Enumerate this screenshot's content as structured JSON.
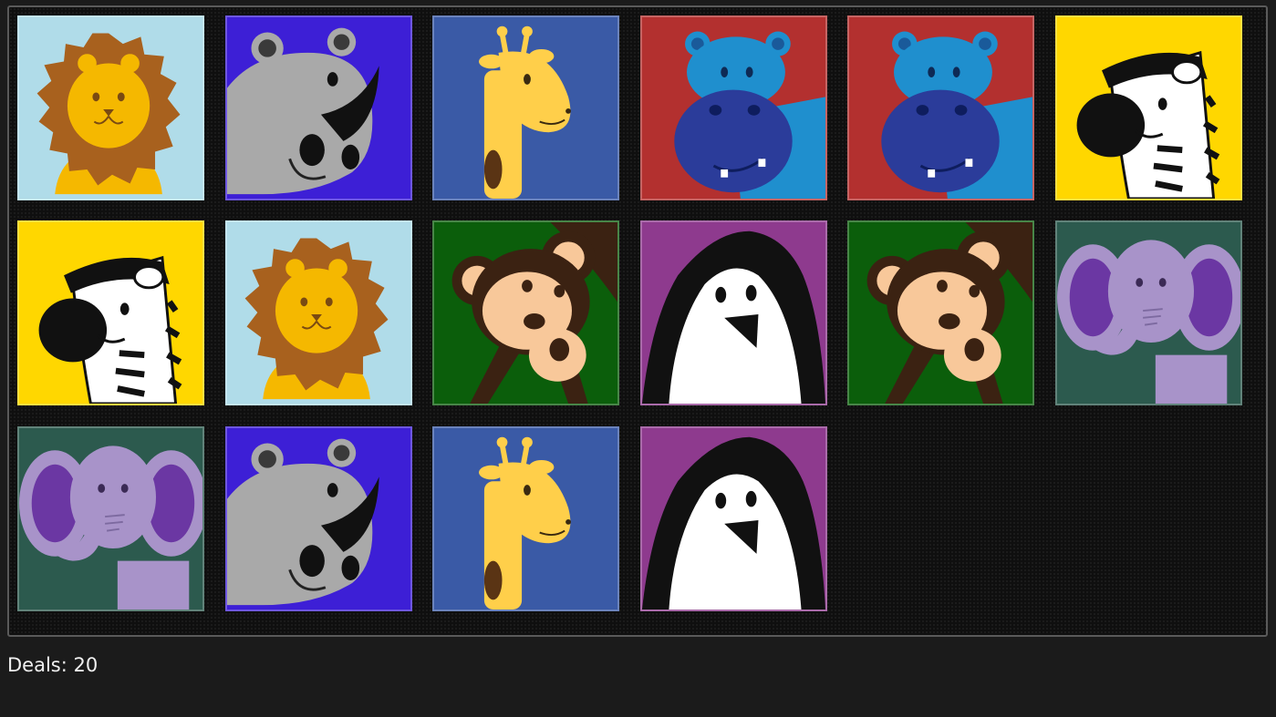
{
  "status": {
    "deals_label": "Deals: 20"
  },
  "board": {
    "cards": [
      {
        "animal": "lion",
        "background": "#b0dce9"
      },
      {
        "animal": "rhino",
        "background": "#3d1fd6"
      },
      {
        "animal": "giraffe",
        "background": "#3a5aa6"
      },
      {
        "animal": "hippo",
        "background": "#b3302f"
      },
      {
        "animal": "hippo",
        "background": "#b3302f"
      },
      {
        "animal": "zebra",
        "background": "#ffd700"
      },
      {
        "animal": "zebra",
        "background": "#ffd700"
      },
      {
        "animal": "lion",
        "background": "#b0dce9"
      },
      {
        "animal": "monkey",
        "background": "#0b5e0b"
      },
      {
        "animal": "penguin",
        "background": "#8e3a8e"
      },
      {
        "animal": "monkey",
        "background": "#0b5e0b"
      },
      {
        "animal": "elephant",
        "background": "#2c5a4e"
      },
      {
        "animal": "elephant",
        "background": "#2c5a4e"
      },
      {
        "animal": "rhino",
        "background": "#3d1fd6"
      },
      {
        "animal": "giraffe",
        "background": "#3a5aa6"
      },
      {
        "animal": "penguin",
        "background": "#8e3a8e"
      }
    ]
  }
}
